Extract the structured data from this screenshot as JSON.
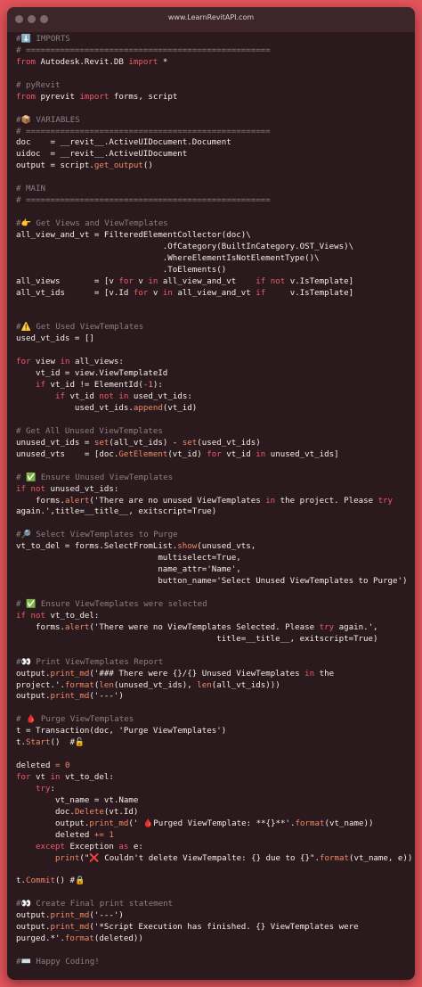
{
  "window": {
    "url": "www.LearnRevitAPI.com"
  },
  "code_lines": [
    "#⬇️ IMPORTS",
    "# ==================================================",
    "from Autodesk.Revit.DB import *",
    "",
    "# pyRevit",
    "from pyrevit import forms, script",
    "",
    "#📦 VARIABLES",
    "# ==================================================",
    "doc    = __revit__.ActiveUIDocument.Document",
    "uidoc  = __revit__.ActiveUIDocument",
    "output = script.get_output()",
    "",
    "# MAIN",
    "# ==================================================",
    "",
    "#👉 Get Views and ViewTemplates",
    "all_view_and_vt = FilteredElementCollector(doc)\\",
    "                              .OfCategory(BuiltInCategory.OST_Views)\\",
    "                              .WhereElementIsNotElementType()\\",
    "                              .ToElements()",
    "all_views       = [v for v in all_view_and_vt    if not v.IsTemplate]",
    "all_vt_ids      = [v.Id for v in all_view_and_vt if     v.IsTemplate]",
    "",
    "",
    "#⚠️ Get Used ViewTemplates",
    "used_vt_ids = []",
    "",
    "for view in all_views:",
    "    vt_id = view.ViewTemplateId",
    "    if vt_id != ElementId(-1):",
    "        if vt_id not in used_vt_ids:",
    "            used_vt_ids.append(vt_id)",
    "",
    "# Get All Unused ViewTemplates",
    "unused_vt_ids = set(all_vt_ids) - set(used_vt_ids)",
    "unused_vts    = [doc.GetElement(vt_id) for vt_id in unused_vt_ids]",
    "",
    "# ✅ Ensure Unused ViewTemplates",
    "if not unused_vt_ids:",
    "    forms.alert('There are no unused ViewTemplates in the project. Please try",
    "again.',title=__title__, exitscript=True)",
    "",
    "#🔎 Select ViewTemplates to Purge",
    "vt_to_del = forms.SelectFromList.show(unused_vts,",
    "                             multiselect=True,",
    "                             name_attr='Name',",
    "                             button_name='Select Unused ViewTemplates to Purge')",
    "",
    "# ✅ Ensure ViewTemplates were selected",
    "if not vt_to_del:",
    "    forms.alert('There were no ViewTemplates Selected. Please try again.',",
    "                                         title=__title__, exitscript=True)",
    "",
    "#👀 Print ViewTemplates Report",
    "output.print_md('### There were {}/{} Unused ViewTemplates in the",
    "project.'.format(len(unused_vt_ids), len(all_vt_ids)))",
    "output.print_md('---')",
    "",
    "# 🩸 Purge ViewTemplates",
    "t = Transaction(doc, 'Purge ViewTemplates')",
    "t.Start()  #🔓",
    "",
    "deleted = 0",
    "for vt in vt_to_del:",
    "    try:",
    "        vt_name = vt.Name",
    "        doc.Delete(vt.Id)",
    "        output.print_md(' 🩸Purged ViewTemplate: **{}**'.format(vt_name))",
    "        deleted += 1",
    "    except Exception as e:",
    "        print(\"❌ Couldn't delete ViewTempalte: {} due to {}\".format(vt_name, e))",
    "",
    "t.Commit() #🔒",
    "",
    "#👀 Create Final print statement",
    "output.print_md('---')",
    "output.print_md('*Script Execution has finished. {} ViewTemplates were",
    "purged.*'.format(deleted))",
    "",
    "#⌨️ Happy Coding!"
  ]
}
